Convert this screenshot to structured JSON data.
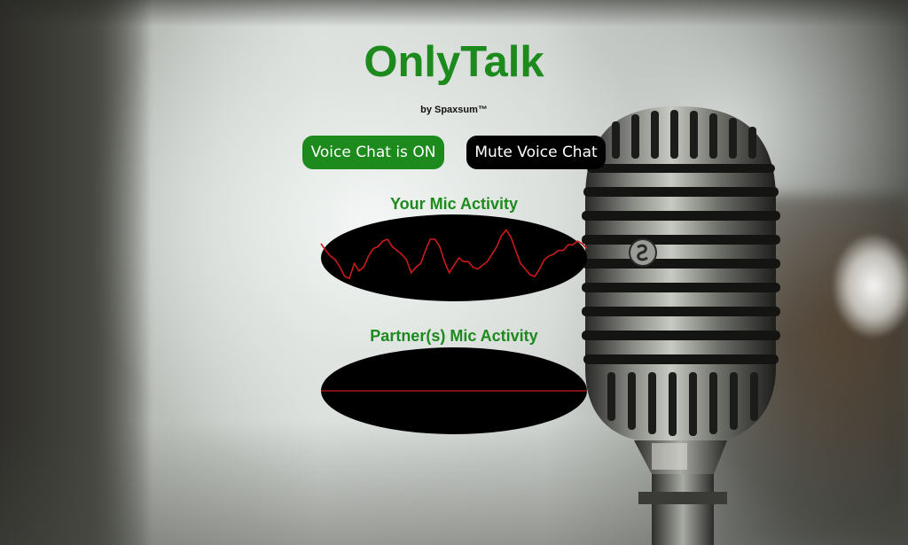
{
  "app": {
    "title": "OnlyTalk",
    "byline": "by Spaxsum™"
  },
  "controls": {
    "voice_status_label": "Voice Chat is ON",
    "mute_label": "Mute Voice Chat"
  },
  "visualizers": {
    "you": {
      "label": "Your Mic Activity",
      "waveform": [
        0.38,
        0.2,
        0.05,
        -0.05,
        -0.25,
        -0.5,
        -0.55,
        -0.15,
        -0.35,
        -0.25,
        0.05,
        0.25,
        0.3,
        0.45,
        0.5,
        0.3,
        0.2,
        0.1,
        -0.05,
        -0.4,
        -0.25,
        -0.15,
        0.2,
        0.5,
        0.5,
        0.3,
        -0.1,
        -0.4,
        -0.2,
        0.0,
        -0.1,
        -0.1,
        -0.25,
        -0.3,
        -0.2,
        -0.1,
        0.1,
        0.3,
        0.6,
        0.75,
        0.55,
        0.2,
        -0.15,
        -0.3,
        -0.45,
        -0.5,
        -0.3,
        -0.05,
        0.05,
        0.1,
        0.2,
        0.2,
        0.35,
        0.35,
        0.45,
        0.38,
        0.25
      ]
    },
    "partner": {
      "label": "Partner(s) Mic Activity",
      "waveform": [
        0,
        0,
        0,
        0,
        0
      ]
    }
  },
  "colors": {
    "brand_green": "#1c8a1c",
    "scope_bg": "#000000",
    "waveform": "#cc1a1a"
  },
  "icons": {
    "background": "microphone-photo"
  }
}
